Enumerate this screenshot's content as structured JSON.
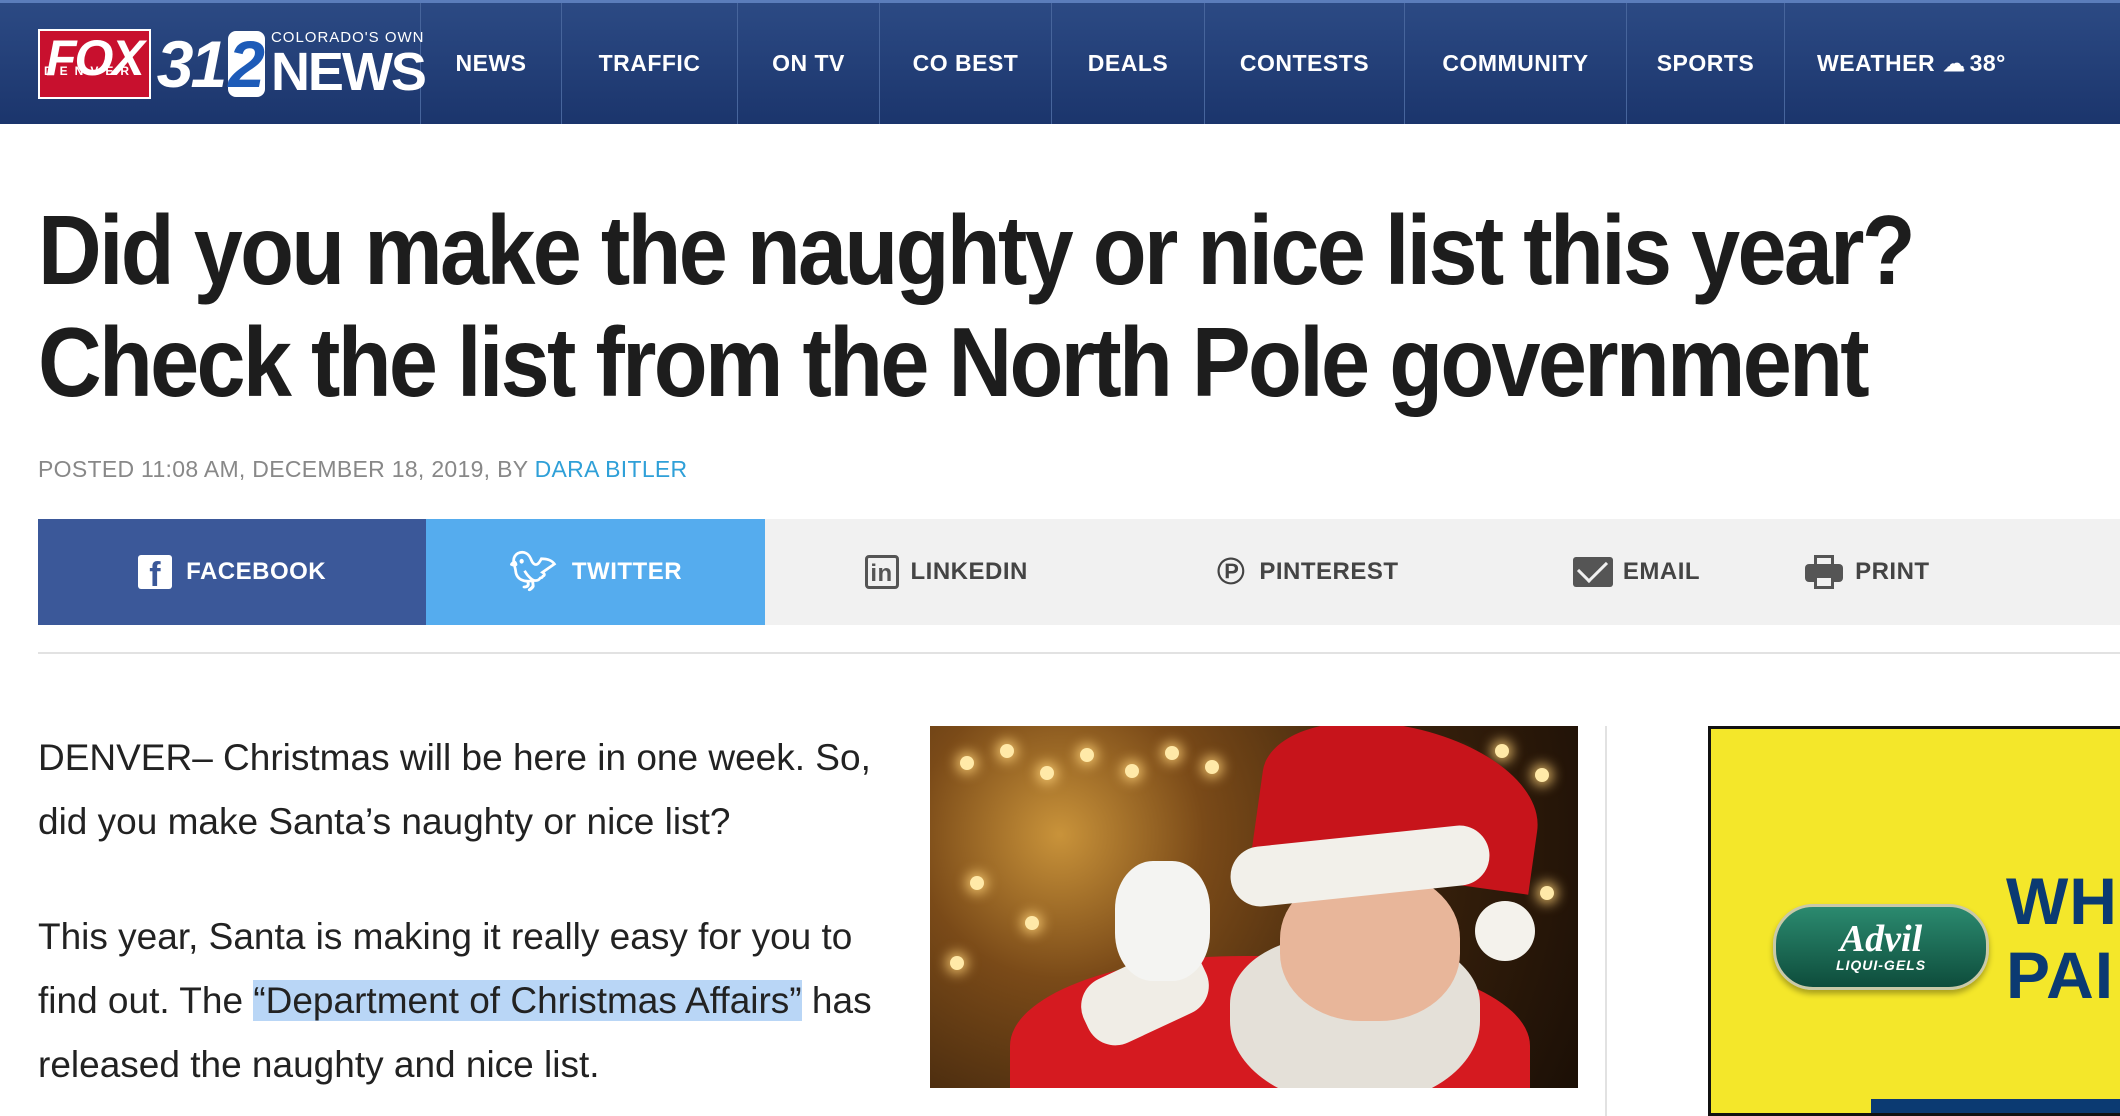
{
  "logo": {
    "fox": "FOX",
    "denver": "DENVER",
    "channel31": "31",
    "channel2": "2",
    "tagline": "COLORADO'S OWN",
    "news": "NEWS"
  },
  "nav": {
    "items": [
      "NEWS",
      "TRAFFIC",
      "ON TV",
      "CO BEST",
      "DEALS",
      "CONTESTS",
      "COMMUNITY",
      "SPORTS"
    ],
    "weather_label": "WEATHER",
    "weather_icon": "cloud-icon",
    "weather_temp": "38°"
  },
  "article": {
    "headline_line1": "Did you make the naughty or nice list this year?",
    "headline_line2": "Check the list from the North Pole government",
    "byline_prefix": "POSTED 11:08 AM, DECEMBER 18, 2019, BY ",
    "author": "DARA BITLER",
    "p1": "DENVER– Christmas will be here in one week. So, did you make Santa’s naughty or nice list?",
    "p2_before": "This year, Santa is making it really easy for you to find out. The ",
    "p2_highlight": "“Department of Christmas Affairs”",
    "p2_after": " has released the naughty and nice list."
  },
  "share": {
    "facebook": "FACEBOOK",
    "twitter": "TWITTER",
    "linkedin": "LINKEDIN",
    "pinterest": "PINTEREST",
    "email": "EMAIL",
    "print": "PRINT"
  },
  "ad": {
    "brand": "Advil",
    "sub": "LIQUI-GELS",
    "text_line1": "WH",
    "text_line2": "PAI"
  },
  "colors": {
    "nav_bg": "#1f3b73",
    "facebook": "#3b5899",
    "twitter": "#55acee",
    "link": "#2fa0d8",
    "highlight": "#b9d6f6",
    "ad_bg": "#f4e72a"
  }
}
